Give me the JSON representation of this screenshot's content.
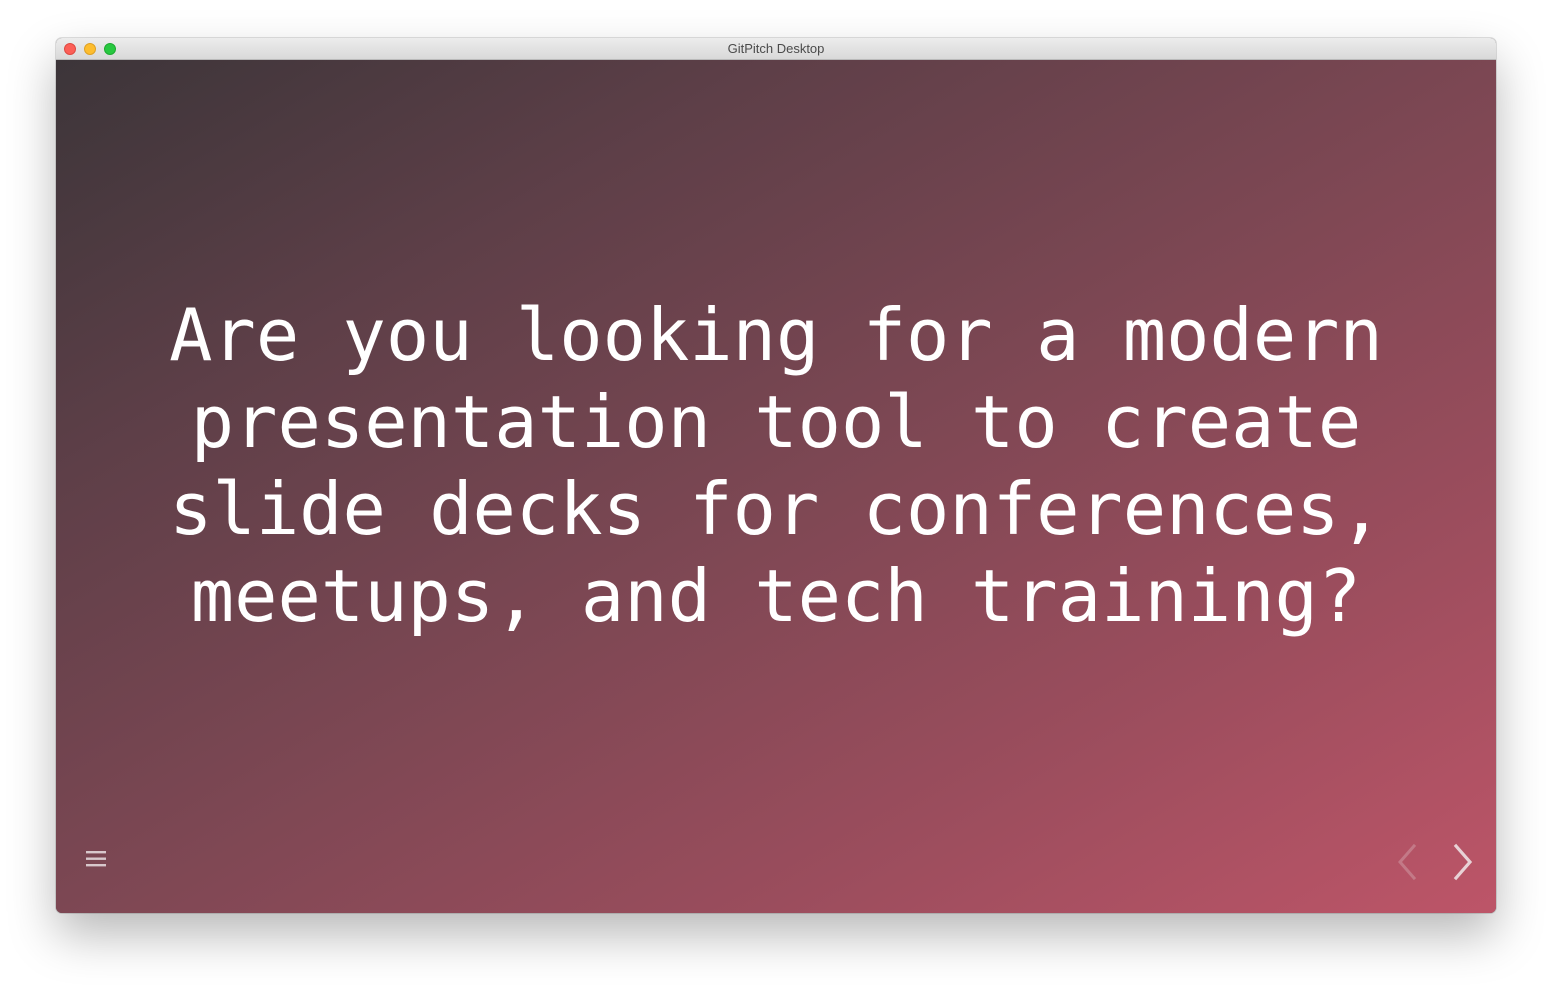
{
  "window": {
    "title": "GitPitch Desktop"
  },
  "slide": {
    "lines": [
      "Are you looking for a modern",
      "presentation tool to create",
      "slide decks for conferences,",
      "meetups, and tech training?"
    ]
  },
  "controls": {
    "menu_icon": "hamburger-menu-icon",
    "prev_icon": "chevron-left-icon",
    "next_icon": "chevron-right-icon"
  },
  "colors": {
    "gradient_start": "#3c3539",
    "gradient_end": "#bd5568",
    "text": "#ffffff"
  }
}
